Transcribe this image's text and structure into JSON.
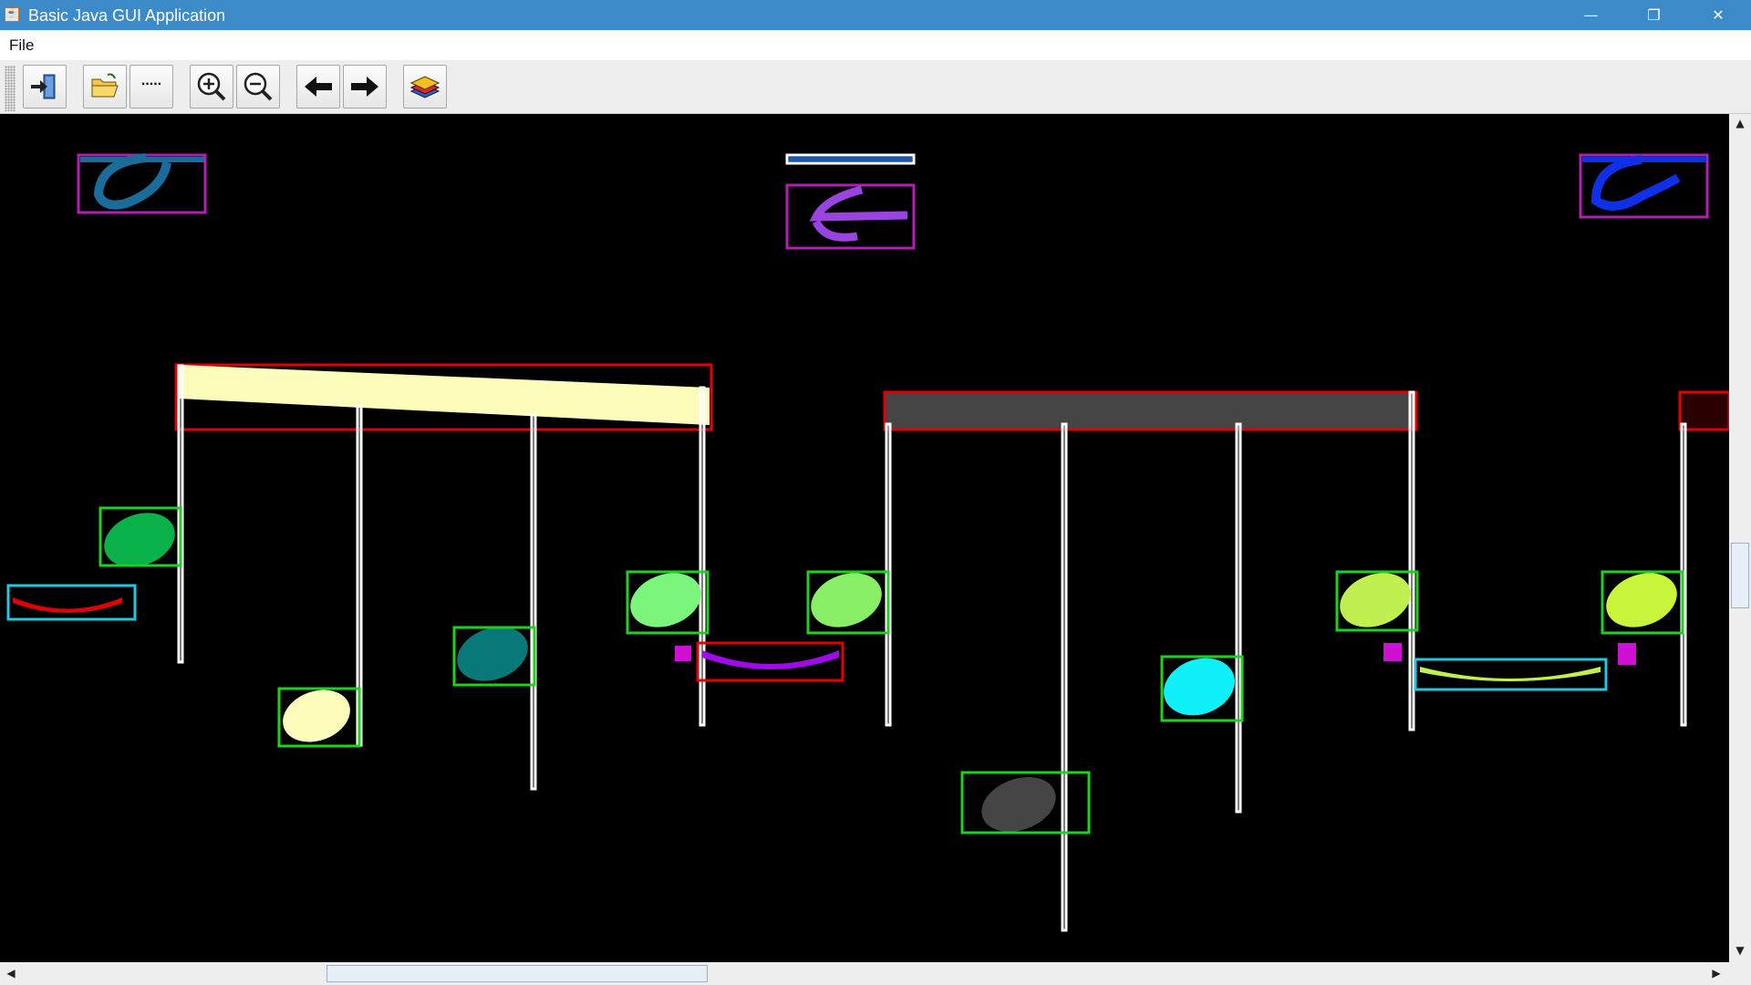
{
  "window": {
    "title": "Basic Java GUI Application",
    "icon": "java-cup-icon",
    "controls": [
      "minimize-icon",
      "restore-icon",
      "close-icon"
    ],
    "control_glyphs": [
      "—",
      "❐",
      "✕"
    ],
    "titlebar_color": "#3c8bc8"
  },
  "menu": {
    "items": [
      {
        "label": "File"
      }
    ]
  },
  "toolbar": {
    "buttons": [
      {
        "name": "exit-button",
        "icon": "exit-door-icon"
      },
      {
        "name": "open-button",
        "icon": "open-folder-icon"
      },
      {
        "name": "more-button",
        "label": "....."
      },
      {
        "name": "zoom-in-button",
        "icon": "zoom-in-icon"
      },
      {
        "name": "zoom-out-button",
        "icon": "zoom-out-icon"
      },
      {
        "name": "back-button",
        "icon": "arrow-left-icon"
      },
      {
        "name": "forward-button",
        "icon": "arrow-right-icon"
      },
      {
        "name": "layers-button",
        "icon": "layers-icon"
      }
    ]
  },
  "canvas": {
    "background": "#000000",
    "description_colors": {
      "note_head_box": "#1fd11f",
      "beam_box": "#e00000",
      "rest_box": "#22c8e0",
      "clef_box": "#aa10aa",
      "stem": "#ffffff"
    }
  },
  "scrollbars": {
    "vertical_position": 0.44,
    "horizontal_position": 0.19
  }
}
